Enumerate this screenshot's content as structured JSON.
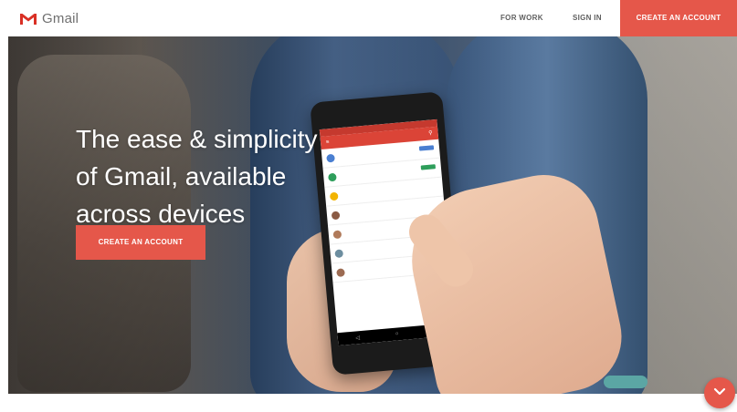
{
  "header": {
    "logo_text": "Gmail",
    "logo_icon": "gmail-m-icon",
    "nav": {
      "for_work": "FOR WORK",
      "sign_in": "SIGN IN",
      "create_account": "CREATE AN ACCOUNT"
    }
  },
  "hero": {
    "title": "The ease & simplicity\nof Gmail, available\nacross devices",
    "cta": "CREATE AN ACCOUNT",
    "scroll_icon": "chevron-down-icon"
  },
  "colors": {
    "accent": "#e5574a",
    "gmail_red": "#db4437"
  }
}
